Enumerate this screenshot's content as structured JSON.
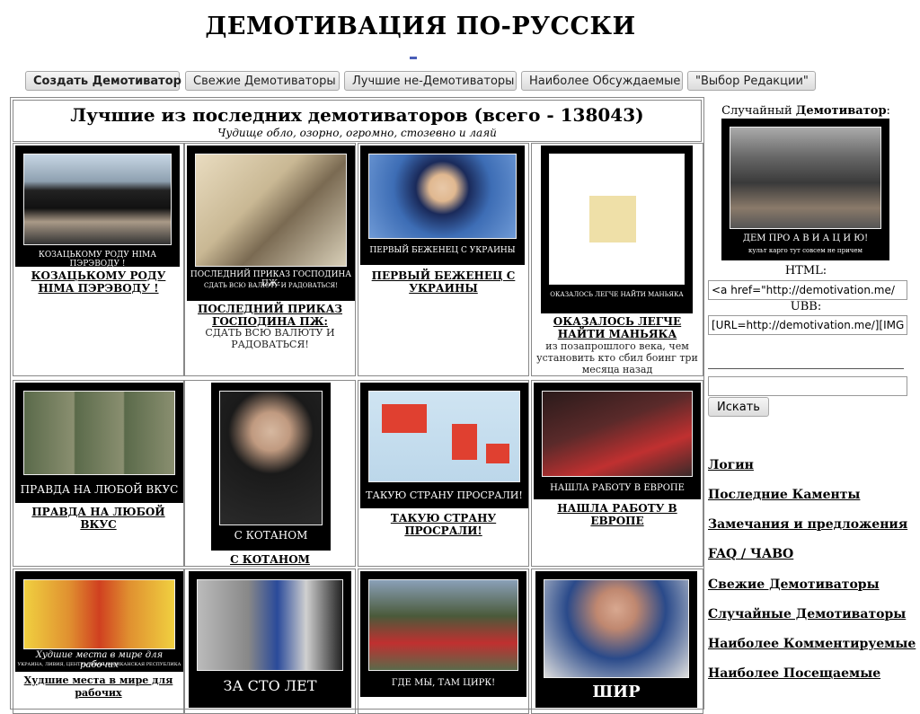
{
  "site": {
    "title": "ДЕМОТИВАЦИЯ ПО-РУССКИ"
  },
  "nav": [
    {
      "label": "Создать Демотиватор"
    },
    {
      "label": "Свежие Демотиваторы"
    },
    {
      "label": "Лучшие не-Демотиваторы"
    },
    {
      "label": "Наиболее Обсуждаемые"
    },
    {
      "label": "\"Выбор Редакции\""
    }
  ],
  "main": {
    "heading": "Лучшие из последних демотиваторов (всего - 138043)",
    "subheading": "Чудище обло, озорно, огромно, стозевно и лаяй",
    "items": [
      {
        "caption": "КОЗАЦЬКОМУ РОДУ НІМА ПЭРЭВОДУ !",
        "caption_sub": "",
        "link": "КОЗАЦЬКОМУ РОДУ НІМА ПЭРЭВОДУ !",
        "desc": ""
      },
      {
        "caption": "ПОСЛЕДНИЙ ПРИКАЗ ГОСПОДИНА ПЖ:",
        "caption_sub": "СДАТЬ ВСЮ ВАЛЮТУ И РАДОВАТЬСЯ!",
        "link": "ПОСЛЕДНИЙ ПРИКАЗ ГОСПОДИНА ПЖ:",
        "desc": "СДАТЬ ВСЮ ВАЛЮТУ И РАДОВАТЬСЯ!"
      },
      {
        "caption": "ПЕРВЫЙ БЕЖЕНЕЦ С УКРАИНЫ",
        "caption_sub": "",
        "link": "ПЕРВЫЙ БЕЖЕНЕЦ С УКРАИНЫ",
        "desc": ""
      },
      {
        "caption": "ОКАЗАЛОСЬ ЛЕГЧЕ НАЙТИ МАНЬЯКА",
        "caption_sub": "из позапрошлого века, чем установить кто сбил боинг три месяца назад",
        "link": "ОКАЗАЛОСЬ ЛЕГЧЕ НАЙТИ МАНЬЯКА",
        "desc": "из позапрошлого века, чем установить кто сбил боинг три месяца назад"
      },
      {
        "caption": "ПРАВДА НА ЛЮБОЙ ВКУС",
        "caption_sub": "",
        "link": "ПРАВДА НА ЛЮБОЙ ВКУС",
        "desc": ""
      },
      {
        "caption": "С КОТАНОМ",
        "caption_sub": "",
        "link": "С КОТАНОМ",
        "desc": ""
      },
      {
        "caption": "ТАКУЮ СТРАНУ ПРОСРАЛИ!",
        "caption_sub": "",
        "link": "ТАКУЮ СТРАНУ ПРОСРАЛИ!",
        "desc": ""
      },
      {
        "caption": "НАШЛА РАБОТУ В ЕВРОПЕ",
        "caption_sub": "",
        "link": "НАШЛА РАБОТУ В ЕВРОПЕ",
        "desc": ""
      },
      {
        "caption": "Худшие места в мире для рабочих",
        "caption_sub": "УКРАИНА, ЛИВИЯ, ЦЕНТРАЛЬНАЯ АФРИКАНСКАЯ РЕСПУБЛИКА",
        "link": "Худшие места в мире для рабочих",
        "desc": ""
      },
      {
        "caption": "ЗА СТО ЛЕТ",
        "caption_sub": "",
        "link": "",
        "desc": ""
      },
      {
        "caption": "ГДЕ МЫ, ТАМ ЦИРК!",
        "caption_sub": "",
        "link": "",
        "desc": ""
      },
      {
        "caption": "ШИР",
        "caption_sub": "",
        "link": "",
        "desc": ""
      }
    ]
  },
  "sidebar": {
    "random_prefix": "Случайный",
    "random_bold": "Демотиватор",
    "random_suffix": ":",
    "random_caption": "ДЕМ ПРО А В И А Ц И Ю!",
    "random_caption_sub": "культ карго тут совсем не причем",
    "html_label": "HTML:",
    "html_value": "<a href=\"http://demotivation.me/",
    "ubb_label": "UBB:",
    "ubb_value": "[URL=http://demotivation.me/][IMG",
    "search_value": "",
    "search_button": "Искать",
    "menu": [
      {
        "label": "Логин"
      },
      {
        "label": "Последние Каменты"
      },
      {
        "label": "Замечания и предложения"
      },
      {
        "label": "FAQ / ЧАВО"
      },
      {
        "label": "Свежие Демотиваторы"
      },
      {
        "label": "Случайные Демотиваторы"
      },
      {
        "label": "Наиболее Комментируемые"
      },
      {
        "label": "Наиболее Посещаемые"
      }
    ]
  }
}
